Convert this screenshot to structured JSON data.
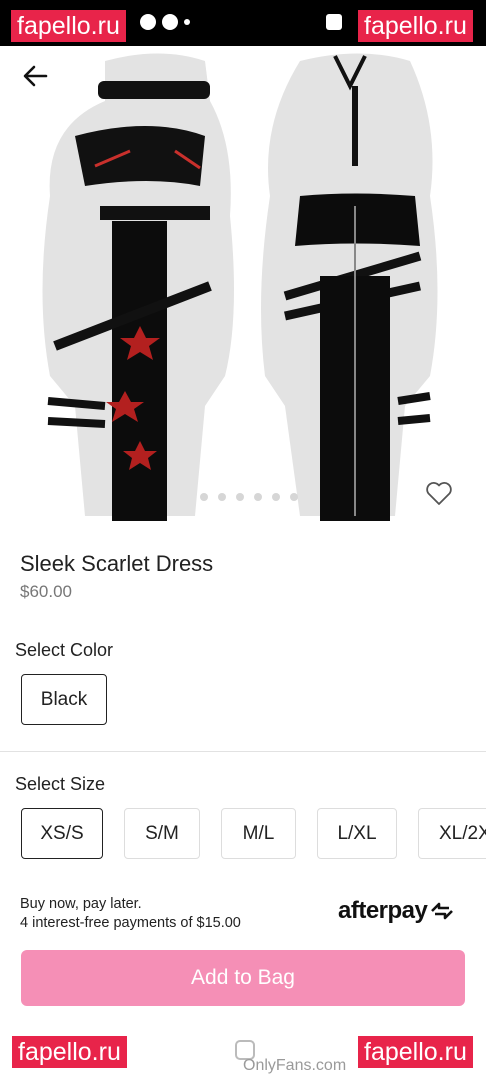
{
  "watermark": {
    "text": "fapello.ru"
  },
  "bottom_watermark": {
    "text": "OnlyFans.com"
  },
  "product": {
    "title": "Sleek Scarlet Dress",
    "price": "$60.00",
    "image_count": 6,
    "active_image_index": 0
  },
  "color": {
    "label": "Select Color",
    "options": [
      "Black"
    ],
    "selected": "Black"
  },
  "size": {
    "label": "Select Size",
    "options": [
      "XS/S",
      "S/M",
      "M/L",
      "L/XL",
      "XL/2X"
    ],
    "selected": "XS/S"
  },
  "afterpay": {
    "line1": "Buy now, pay later.",
    "line2": "4 interest-free payments of $15.00",
    "logo_text": "afterpay"
  },
  "cta": {
    "label": "Add to Bag",
    "color": "#f58fb6"
  },
  "colors": {
    "accent": "#f58fb6",
    "watermark": "#e8244a"
  },
  "icons": {
    "back": "arrow-left-icon",
    "favorite": "heart-outline-icon"
  }
}
